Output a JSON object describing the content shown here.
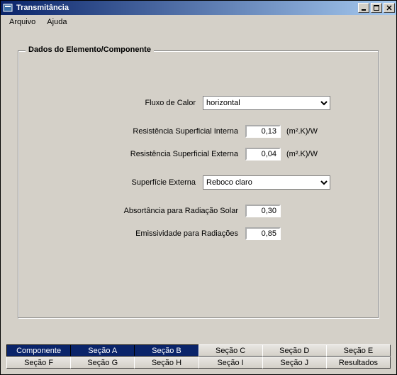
{
  "window": {
    "title": "Transmitância",
    "menu": {
      "file": "Arquivo",
      "help": "Ajuda"
    },
    "buttons": {
      "min": "_",
      "max": "□",
      "close": "✕"
    }
  },
  "group": {
    "title": "Dados do Elemento/Componente"
  },
  "fields": {
    "fluxo_label": "Fluxo de Calor",
    "fluxo_value": "horizontal",
    "rsi_label": "Resistência Superficial Interna",
    "rsi_value": "0,13",
    "rsi_unit": "(m².K)/W",
    "rse_label": "Resistência Superficial Externa",
    "rse_value": "0,04",
    "rse_unit": "(m².K)/W",
    "sup_label": "Superfície Externa",
    "sup_value": "Reboco claro",
    "abs_label": "Absortância para Radiação Solar",
    "abs_value": "0,30",
    "emi_label": "Emissividade para Radiações",
    "emi_value": "0,85"
  },
  "tabs": {
    "row1": [
      "Componente",
      "Seção A",
      "Seção B",
      "Seção C",
      "Seção D",
      "Seção E"
    ],
    "row2": [
      "Seção F",
      "Seção G",
      "Seção H",
      "Seção I",
      "Seção J",
      "Resultados"
    ],
    "active": [
      0,
      1,
      2
    ]
  }
}
